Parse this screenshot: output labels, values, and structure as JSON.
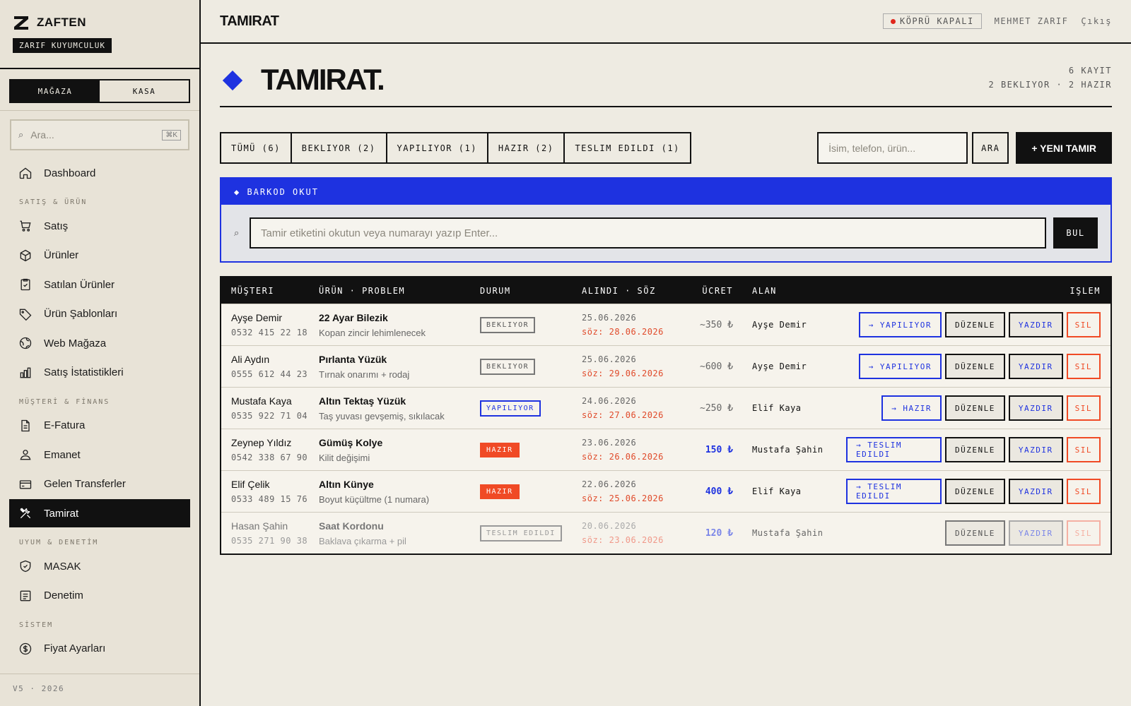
{
  "brand": {
    "name": "ZAFTEN",
    "tagline": "ZARIF KUYUMCULUK"
  },
  "modes": [
    {
      "label": "MAĞAZA",
      "active": true
    },
    {
      "label": "KASA",
      "active": false
    }
  ],
  "sidebar_search": {
    "placeholder": "Ara...",
    "shortcut": "⌘K"
  },
  "nav": {
    "dashboard": "Dashboard",
    "group_sales": "SATIŞ & ÜRÜN",
    "satis": "Satış",
    "urunler": "Ürünler",
    "satilan": "Satılan Ürünler",
    "sablonlar": "Ürün Şablonları",
    "web": "Web Mağaza",
    "istatistik": "Satış İstatistikleri",
    "group_finance": "MÜŞTERİ & FİNANS",
    "efatura": "E-Fatura",
    "emanet": "Emanet",
    "transfer": "Gelen Transferler",
    "tamirat": "Tamirat",
    "group_compliance": "UYUM & DENETİM",
    "masak": "MASAK",
    "denetim": "Denetim",
    "group_system": "SİSTEM",
    "fiyat": "Fiyat Ayarları"
  },
  "version": "V5 · 2026",
  "topbar": {
    "title": "TAMIRAT",
    "bridge_status": "KÖPRÜ KAPALI",
    "user": "MEHMET ZARIF",
    "logout": "Çıkış"
  },
  "hero": {
    "title": "TAMIRAT.",
    "count": "6 KAYIT",
    "summary": "2 BEKLIYOR · 2 HAZIR"
  },
  "filters": [
    "TÜMÜ (6)",
    "BEKLIYOR (2)",
    "YAPILIYOR (1)",
    "HAZIR (2)",
    "TESLIM EDILDI (1)"
  ],
  "search": {
    "placeholder": "İsim, telefon, ürün...",
    "button": "ARA",
    "new_button": "+ YENI TAMIR"
  },
  "barcode": {
    "title": "◆ BARKOD OKUT",
    "placeholder": "Tamir etiketini okutun veya numarayı yazıp Enter...",
    "button": "BUL"
  },
  "table": {
    "headers": [
      "MÜŞTERI",
      "ÜRÜN · PROBLEM",
      "DURUM",
      "ALINDI · SÖZ",
      "ÜCRET",
      "ALAN",
      "IŞLEM"
    ],
    "rows": [
      {
        "customer": "Ayşe Demir",
        "phone": "0532 415 22 18",
        "product": "22 Ayar Bilezik",
        "problem": "Kopan zincir lehimlenecek",
        "status": "BEKLIYOR",
        "received": "25.06.2026",
        "promise": "söz: 28.06.2026",
        "fee": "~350 ₺",
        "taker": "Ayşe Demir",
        "advance": "→ YAPILIYOR",
        "edit": "DÜZENLE",
        "print": "YAZDIR",
        "delete": "SIL"
      },
      {
        "customer": "Ali Aydın",
        "phone": "0555 612 44 23",
        "product": "Pırlanta Yüzük",
        "problem": "Tırnak onarımı + rodaj",
        "status": "BEKLIYOR",
        "received": "25.06.2026",
        "promise": "söz: 29.06.2026",
        "fee": "~600 ₺",
        "taker": "Ayşe Demir",
        "advance": "→ YAPILIYOR",
        "edit": "DÜZENLE",
        "print": "YAZDIR",
        "delete": "SIL"
      },
      {
        "customer": "Mustafa Kaya",
        "phone": "0535 922 71 04",
        "product": "Altın Tektaş Yüzük",
        "problem": "Taş yuvası gevşemiş, sıkılacak",
        "status": "YAPILIYOR",
        "received": "24.06.2026",
        "promise": "söz: 27.06.2026",
        "fee": "~250 ₺",
        "taker": "Elif Kaya",
        "advance": "→ HAZIR",
        "edit": "DÜZENLE",
        "print": "YAZDIR",
        "delete": "SIL"
      },
      {
        "customer": "Zeynep Yıldız",
        "phone": "0542 338 67 90",
        "product": "Gümüş Kolye",
        "problem": "Kilit değişimi",
        "status": "HAZIR",
        "received": "23.06.2026",
        "promise": "söz: 26.06.2026",
        "fee": "150 ₺",
        "taker": "Mustafa Şahin",
        "advance": "→ TESLIM EDILDI",
        "edit": "DÜZENLE",
        "print": "YAZDIR",
        "delete": "SIL"
      },
      {
        "customer": "Elif Çelik",
        "phone": "0533 489 15 76",
        "product": "Altın Künye",
        "problem": "Boyut küçültme (1 numara)",
        "status": "HAZIR",
        "received": "22.06.2026",
        "promise": "söz: 25.06.2026",
        "fee": "400 ₺",
        "taker": "Elif Kaya",
        "advance": "→ TESLIM EDILDI",
        "edit": "DÜZENLE",
        "print": "YAZDIR",
        "delete": "SIL"
      },
      {
        "customer": "Hasan Şahin",
        "phone": "0535 271 90 38",
        "product": "Saat Kordonu",
        "problem": "Baklava çıkarma + pil",
        "status": "TESLIM EDILDI",
        "received": "20.06.2026",
        "promise": "söz: 23.06.2026",
        "fee": "120 ₺",
        "taker": "Mustafa Şahin",
        "advance": "",
        "edit": "DÜZENLE",
        "print": "YAZDIR",
        "delete": "SIL"
      }
    ]
  },
  "colors": {
    "accent": "#1e32e0",
    "danger": "#f04a25",
    "ink": "#111111",
    "paper": "#eeebe2"
  }
}
